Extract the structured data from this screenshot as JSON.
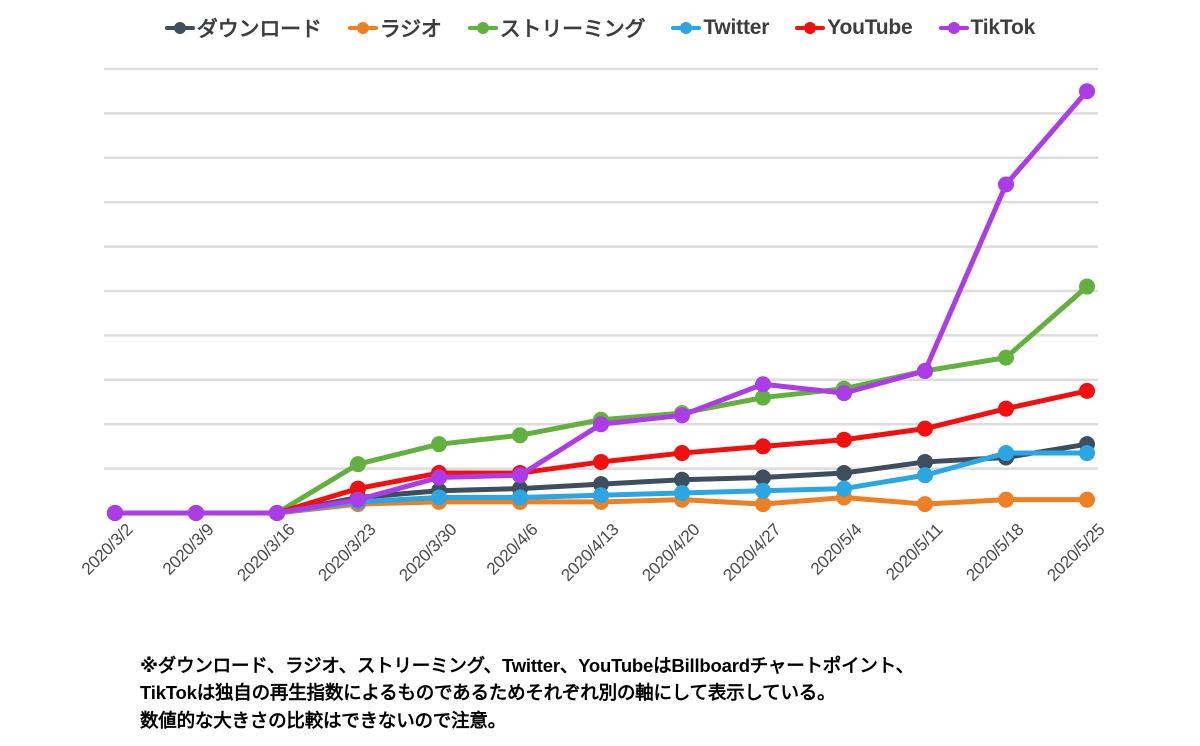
{
  "chart_data": {
    "type": "line",
    "title": "",
    "xlabel": "",
    "ylabel": "",
    "grid": true,
    "legend_position": "top",
    "ylim": [
      0,
      10
    ],
    "y_axis_labels_visible": false,
    "gridline_count": 10,
    "categories": [
      "2020/3/2",
      "2020/3/9",
      "2020/3/16",
      "2020/3/23",
      "2020/3/30",
      "2020/4/6",
      "2020/4/13",
      "2020/4/20",
      "2020/4/27",
      "2020/5/4",
      "2020/5/11",
      "2020/5/18",
      "2020/5/25"
    ],
    "series": [
      {
        "name": "ダウンロード",
        "color": "#3d4f5f",
        "values": [
          0,
          0,
          0,
          0.35,
          0.5,
          0.55,
          0.65,
          0.75,
          0.8,
          0.9,
          1.15,
          1.25,
          1.55
        ]
      },
      {
        "name": "ラジオ",
        "color": "#ee8024",
        "values": [
          0,
          0,
          0,
          0.2,
          0.25,
          0.25,
          0.25,
          0.3,
          0.2,
          0.35,
          0.2,
          0.3,
          0.3
        ]
      },
      {
        "name": "ストリーミング",
        "color": "#62b13e",
        "values": [
          0,
          0,
          0,
          1.1,
          1.55,
          1.75,
          2.1,
          2.25,
          2.6,
          2.8,
          3.2,
          3.5,
          5.1
        ]
      },
      {
        "name": "Twitter",
        "color": "#2aa6e4",
        "values": [
          0,
          0,
          0,
          0.25,
          0.35,
          0.35,
          0.4,
          0.45,
          0.5,
          0.55,
          0.85,
          1.35,
          1.35
        ]
      },
      {
        "name": "YouTube",
        "color": "#f40f0f",
        "values": [
          0,
          0,
          0,
          0.55,
          0.9,
          0.9,
          1.15,
          1.35,
          1.5,
          1.65,
          1.9,
          2.35,
          2.75
        ]
      },
      {
        "name": "TikTok",
        "color": "#ab3ce8",
        "values": [
          0,
          0,
          0,
          0.3,
          0.8,
          0.85,
          2.0,
          2.2,
          2.9,
          2.7,
          3.2,
          7.4,
          9.5
        ]
      }
    ]
  },
  "legend": {
    "items": [
      {
        "label": "ダウンロード",
        "color": "#3d4f5f"
      },
      {
        "label": "ラジオ",
        "color": "#ee8024"
      },
      {
        "label": "ストリーミング",
        "color": "#62b13e"
      },
      {
        "label": "Twitter",
        "color": "#2aa6e4"
      },
      {
        "label": "YouTube",
        "color": "#f40f0f"
      },
      {
        "label": "TikTok",
        "color": "#ab3ce8"
      }
    ]
  },
  "footnote": {
    "line1": "※ダウンロード、ラジオ、ストリーミング、Twitter、YouTubeはBillboardチャートポイント、",
    "line2": "TikTokは独自の再生指数によるものであるためそれぞれ別の軸にして表示している。",
    "line3": "数値的な大きさの比較はできないので注意。"
  },
  "style": {
    "gridline_color": "#dcdcdc",
    "background": "#ffffff",
    "tick_label_color": "#4a4a4a"
  }
}
